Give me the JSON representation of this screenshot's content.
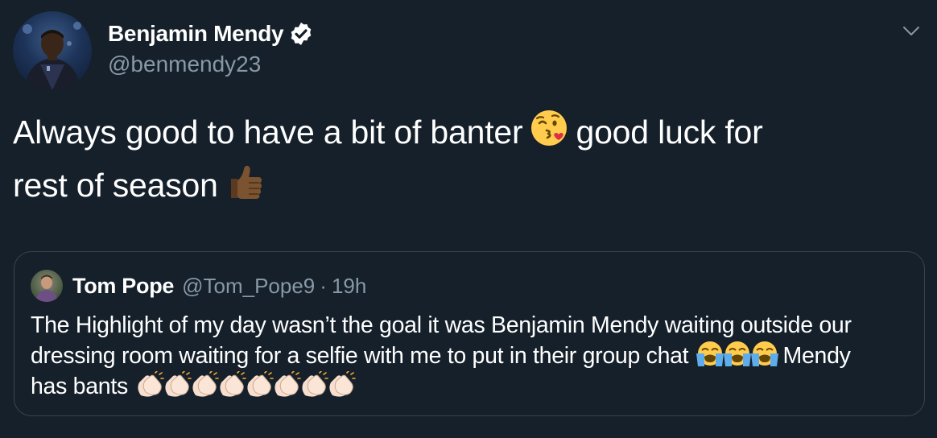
{
  "author": {
    "display_name": "Benjamin Mendy",
    "handle": "@benmendy23",
    "verified": true
  },
  "tweet": {
    "text_part1": "Always good to have a bit of banter",
    "emoji1": "face-throwing-a-kiss",
    "text_part2": "good luck for",
    "text_part3": "rest of season",
    "emoji2": "thumbs-up-dark-skin"
  },
  "quoted_tweet": {
    "display_name": "Tom Pope",
    "handle": "@Tom_Pope9",
    "separator": "·",
    "time": "19h",
    "text_part1": "The Highlight of my day wasn’t the goal it was Benjamin Mendy waiting outside our",
    "text_part2": "dressing room waiting for a selfie with me to put in their group chat",
    "crying_emoji_count": 3,
    "text_part3": "Mendy",
    "text_part4": "has bants",
    "clap_emoji_count": 8
  },
  "colors": {
    "background": "#15202b",
    "primary_text": "#ffffff",
    "secondary_text": "#8899a6",
    "border": "#38444d"
  },
  "icons": {
    "verified": "verified-badge-icon",
    "menu": "chevron-down-icon"
  }
}
